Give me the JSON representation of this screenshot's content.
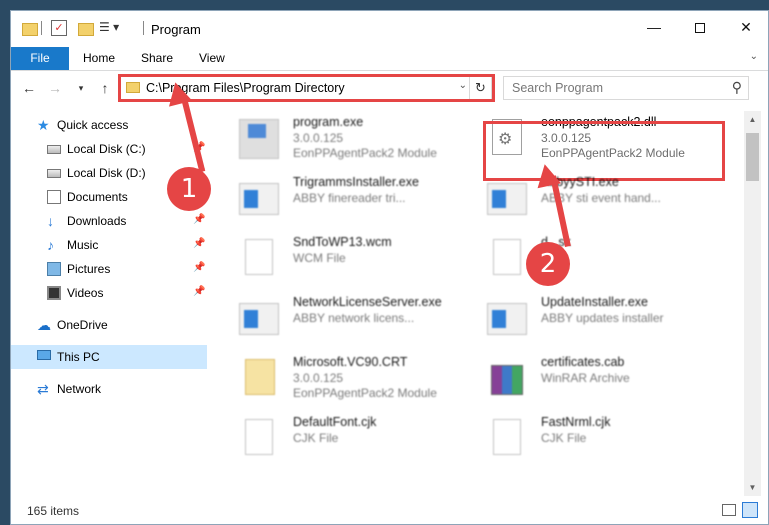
{
  "window": {
    "title": "Program",
    "qa_check_glyph": "✓",
    "qa_props_glyph": "☰ ▾",
    "min_glyph": "—",
    "close_glyph": "✕"
  },
  "ribbon": {
    "tabs": [
      "File",
      "Home",
      "Share",
      "View"
    ],
    "expand_glyph": "⌄"
  },
  "nav": {
    "back_glyph": "←",
    "forward_glyph": "→",
    "recent_glyph": "▾",
    "up_glyph": "↑"
  },
  "address": {
    "path": "C:\\Program Files\\Program Directory",
    "dropdown_glyph": "⌄",
    "refresh_glyph": "↻"
  },
  "search": {
    "placeholder": "Search Program",
    "icon_glyph": "⚲"
  },
  "navpane": {
    "items": [
      {
        "label": "Quick access",
        "glyph": "★"
      },
      {
        "label": "Local Disk (C:)",
        "pinned": true
      },
      {
        "label": "Local Disk (D:)",
        "pinned": true
      },
      {
        "label": "Documents",
        "pinned": true
      },
      {
        "label": "Downloads",
        "pinned": true,
        "glyph": "↓"
      },
      {
        "label": "Music",
        "pinned": true,
        "glyph": "♪"
      },
      {
        "label": "Pictures",
        "pinned": true
      },
      {
        "label": "Videos",
        "pinned": true
      },
      {
        "label": "OneDrive",
        "glyph": "☁"
      },
      {
        "label": "This PC",
        "selected": true
      },
      {
        "label": "Network",
        "glyph": "⇄"
      }
    ],
    "pin_glyph": "📌"
  },
  "files": [
    {
      "name": "program.exe",
      "line2": "3.0.0.125",
      "line3": "EonPPAgentPack2 Module",
      "icon": "setup"
    },
    {
      "name": "eonppagentpack2.dll",
      "line2": "3.0.0.125",
      "line3": "EonPPAgentPack2 Module",
      "icon": "dll",
      "dll_glyph": "⚙"
    },
    {
      "name": "TrigrammsInstaller.exe",
      "line2": "ABBY finereader tri...",
      "icon": "app"
    },
    {
      "name": "AbbyySTI.exe",
      "line2": "ABBY sti event hand...",
      "icon": "app"
    },
    {
      "name": "SndToWP13.wcm",
      "line2": "WCM File",
      "icon": "generic"
    },
    {
      "name": "d...sk",
      "line2": "",
      "icon": "generic"
    },
    {
      "name": "NetworkLicenseServer.exe",
      "line2": "ABBY network licens...",
      "icon": "app"
    },
    {
      "name": "UpdateInstaller.exe",
      "line2": "ABBY updates installer",
      "icon": "app"
    },
    {
      "name": "Microsoft.VC90.CRT",
      "line2": "3.0.0.125",
      "line3": "EonPPAgentPack2 Module",
      "icon": "folderish"
    },
    {
      "name": "certificates.cab",
      "line2": "WinRAR Archive",
      "icon": "rar"
    },
    {
      "name": "DefaultFont.cjk",
      "line2": "CJK File",
      "icon": "generic"
    },
    {
      "name": "FastNrml.cjk",
      "line2": "CJK File",
      "icon": "generic"
    }
  ],
  "scrollbar": {
    "up_glyph": "▲",
    "down_glyph": "▼"
  },
  "status": {
    "item_count": "165 items"
  },
  "annotations": {
    "badge1": "1",
    "badge2": "2"
  },
  "colors": {
    "accent": "#1979ca",
    "highlight": "#e54545",
    "selection": "#cce8ff"
  }
}
